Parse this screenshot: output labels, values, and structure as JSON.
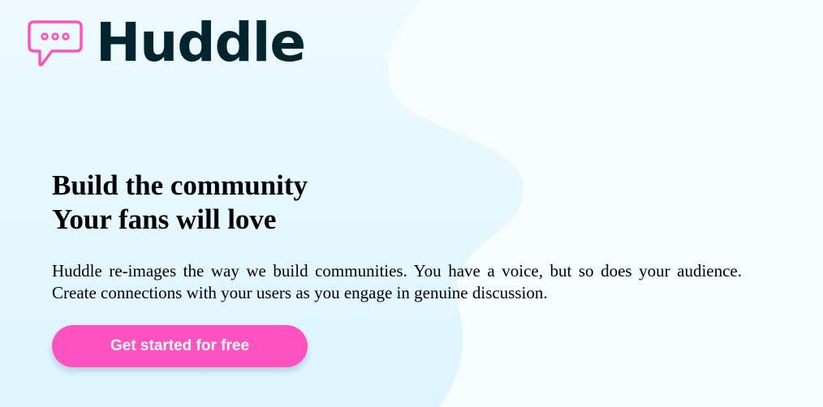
{
  "brand": {
    "name": "Huddle",
    "icon": "chat-bubble-icon",
    "accent_color": "#ff52c1",
    "text_color": "#00252e"
  },
  "hero": {
    "headline_line1": "Build the community",
    "headline_line2": "Your fans will love",
    "description": "Huddle re-images the way we build communities. You have a voice, but so does your audience. Create connections with your users as you engage in genuine discussion.",
    "cta_label": "Get started for free"
  }
}
